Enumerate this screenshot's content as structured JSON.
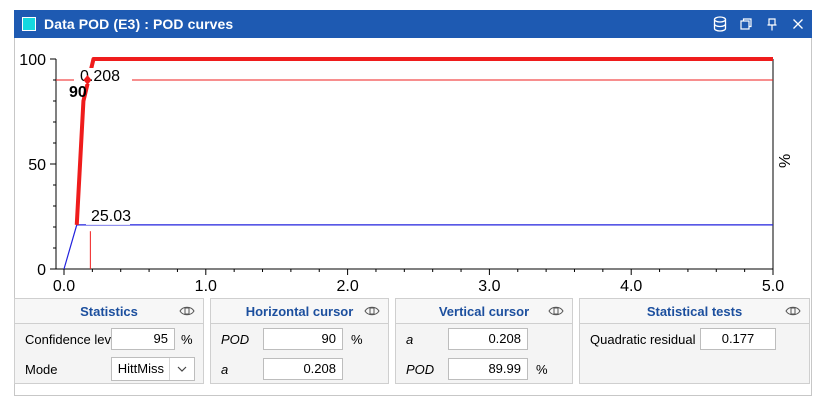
{
  "window": {
    "title": "Data POD (E3) : POD curves",
    "icons": [
      "database-icon",
      "restore-icon",
      "pin-icon",
      "close-icon"
    ]
  },
  "plot": {
    "y_ticks": [
      "0",
      "50",
      "100"
    ],
    "x_ticks": [
      "0.0",
      "1.0",
      "2.0",
      "3.0",
      "4.0",
      "5.0"
    ],
    "y_unit_label": "%",
    "marker_pod_label": "90",
    "marker_a_label": "0.208",
    "lower_curve_label": "25.03",
    "colors": {
      "pod_curve": "#ef1c1c",
      "lower_curve": "#2222dd",
      "axis": "#000000"
    }
  },
  "chart_data": {
    "type": "line",
    "title": "",
    "xlabel": "",
    "ylabel": "%",
    "xlim": [
      0,
      5
    ],
    "ylim": [
      0,
      100
    ],
    "series": [
      {
        "x": [
          0.09,
          0.137,
          0.208,
          5.0
        ],
        "y": [
          21,
          80,
          100,
          100
        ],
        "color": "#ef1c1c"
      },
      {
        "x": [
          0.0,
          0.09,
          0.137,
          5.0
        ],
        "y": [
          0,
          21,
          21,
          21
        ],
        "color": "#2222dd"
      }
    ],
    "cursor": {
      "a": 0.208,
      "pod": 90
    }
  },
  "panels": {
    "statistics": {
      "title": "Statistics",
      "confidence_label": "Confidence level",
      "confidence_value": "95",
      "confidence_unit": "%",
      "mode_label": "Mode",
      "mode_value": "HittMiss"
    },
    "horizontal": {
      "title": "Horizontal cursor",
      "pod_label": "POD",
      "pod_value": "90",
      "pod_unit": "%",
      "a_label": "a",
      "a_value": "0.208"
    },
    "vertical": {
      "title": "Vertical cursor",
      "a_label": "a",
      "a_value": "0.208",
      "pod_label": "POD",
      "pod_value": "89.99",
      "pod_unit": "%"
    },
    "tests": {
      "title": "Statistical tests",
      "quad_label": "Quadratic residual",
      "quad_value": "0.177"
    }
  }
}
